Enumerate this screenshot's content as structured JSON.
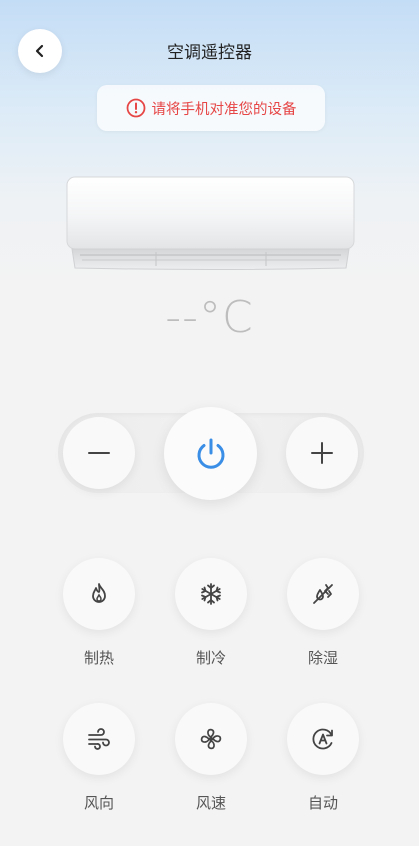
{
  "header": {
    "title": "空调遥控器",
    "back_icon": "chevron-left-icon"
  },
  "warning": {
    "text": "请将手机对准您的设备",
    "icon": "alert-circle-icon",
    "color": "#e64646"
  },
  "temperature": {
    "display": "--°C"
  },
  "controls": {
    "minus_icon": "minus-icon",
    "power_icon": "power-icon",
    "plus_icon": "plus-icon",
    "power_color": "#3a8ee6"
  },
  "modes": [
    {
      "label": "制热",
      "icon": "flame-icon"
    },
    {
      "label": "制冷",
      "icon": "snowflake-icon"
    },
    {
      "label": "除湿",
      "icon": "dehumidify-icon"
    },
    {
      "label": "风向",
      "icon": "wind-icon"
    },
    {
      "label": "风速",
      "icon": "fan-icon"
    },
    {
      "label": "自动",
      "icon": "auto-icon"
    }
  ]
}
